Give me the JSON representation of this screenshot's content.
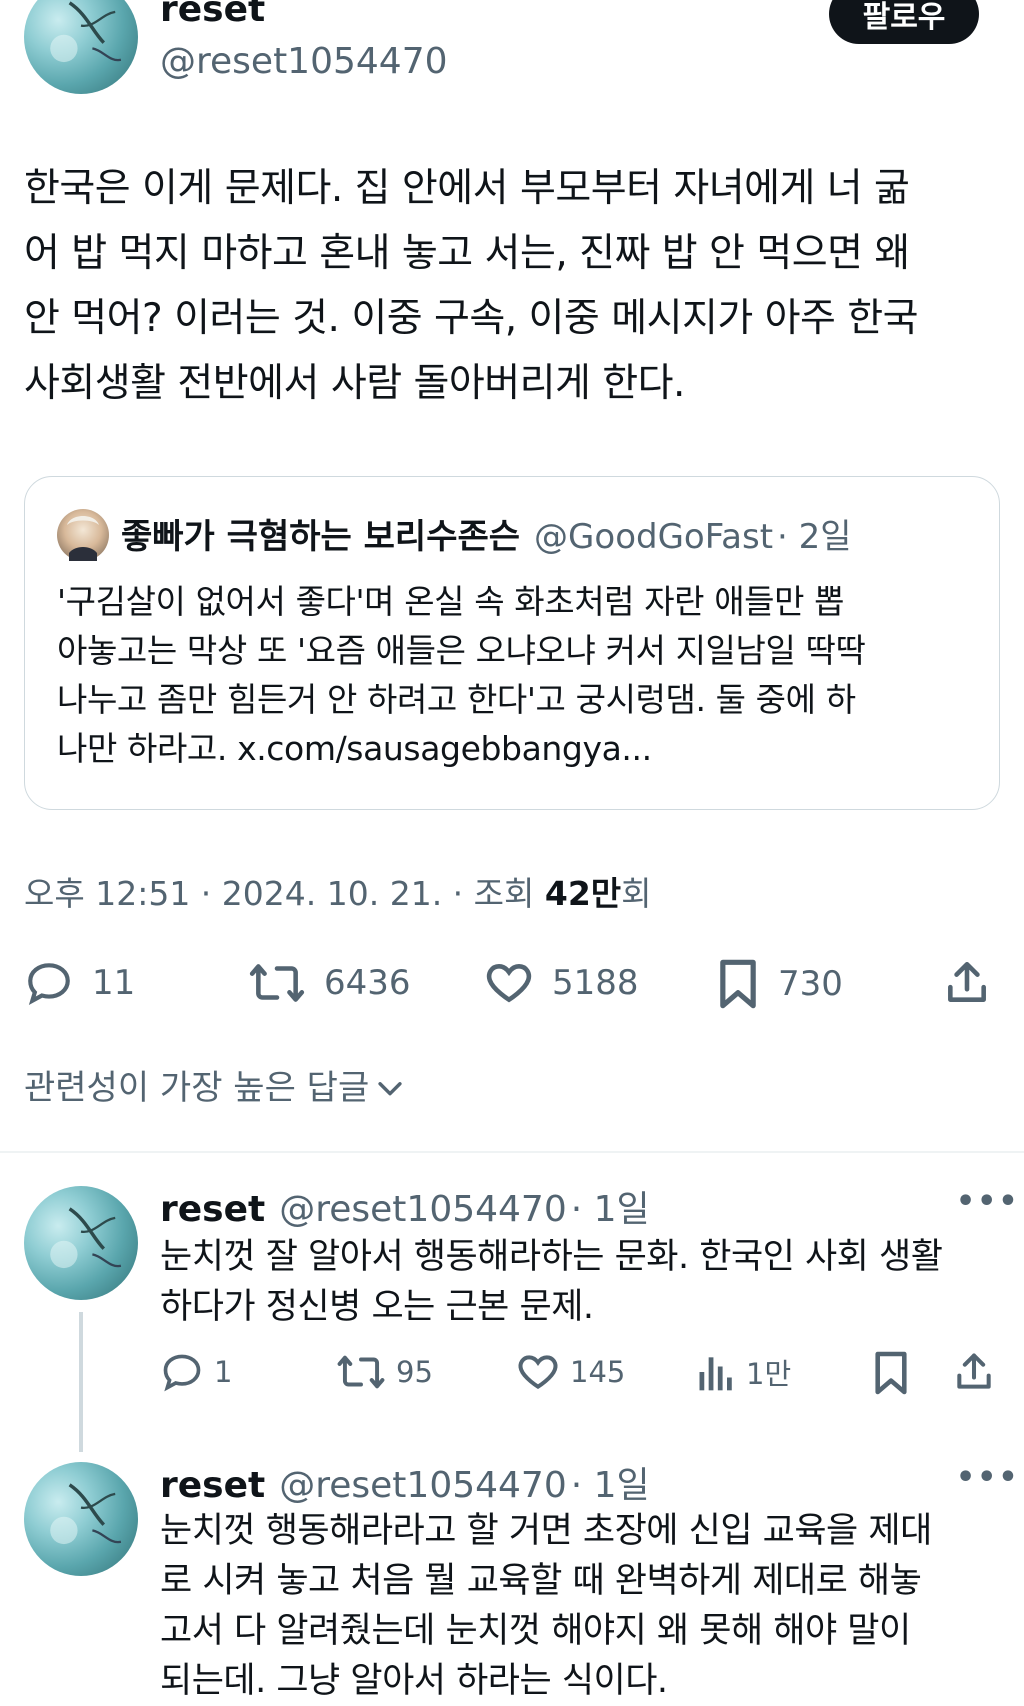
{
  "tweet": {
    "display_name": "reset",
    "handle": "@reset1054470",
    "follow_label": "팔로우",
    "text_lines": [
      "한국은 이게 문제다. 집 안에서 부모부터 자녀에게 너 굶",
      "어 밥 먹지 마하고 혼내 놓고 서는, 진짜 밥 안 먹으면 왜",
      "안 먹어? 이러는 것. 이중 구속, 이중 메시지가 아주 한국",
      "사회생활 전반에서 사람 돌아버리게 한다."
    ],
    "quote": {
      "display_name": "좋빠가 극혐하는 보리수존슨",
      "handle": "@GoodGoFast",
      "time": "· 2일",
      "text_lines": [
        "'구김살이 없어서 좋다'며 온실 속 화초처럼 자란 애들만 뽑",
        "아놓고는 막상 또 '요즘 애들은 오냐오냐 커서 지일남일 딱딱",
        "나누고 좀만 힘든거 안 하려고 한다'고 궁시렁댐. 둘 중에 하",
        "나만 하라고. x.com/sausagebbangya..."
      ]
    },
    "meta": {
      "time_date": "오후 12:51 · 2024. 10. 21. · 조회 ",
      "views_bold": "42만",
      "views_suffix": "회"
    },
    "actions": {
      "replies": "11",
      "retweets": "6436",
      "likes": "5188",
      "bookmarks": "730"
    }
  },
  "sort": {
    "label": "관련성이 가장 높은 답글"
  },
  "replies": [
    {
      "display_name": "reset",
      "handle": "@reset1054470",
      "time": "· 1일",
      "text_lines": [
        "눈치껏 잘 알아서 행동해라하는 문화. 한국인 사회 생활",
        "하다가 정신병 오는 근본 문제."
      ],
      "replies": "1",
      "retweets": "95",
      "likes": "145",
      "views": "1만"
    },
    {
      "display_name": "reset",
      "handle": "@reset1054470",
      "time": "· 1일",
      "text_lines": [
        "눈치껏 행동해라라고 할 거면 초장에 신입 교육을 제대",
        "로 시켜 놓고 처음 뭘 교육할 때 완벽하게 제대로 해놓",
        "고서 다 알려줬는데 눈치껏 해야지 왜 못해 해야 말이",
        "되는데. 그냥 알아서 하라는 식이다."
      ]
    }
  ],
  "icons": {
    "reply": "speech-bubble-icon",
    "retweet": "retweet-icon",
    "like": "heart-icon",
    "bookmark": "bookmark-icon",
    "share": "share-icon",
    "views": "bar-chart-icon",
    "more": "more-dots-icon",
    "chevron": "chevron-down-icon"
  }
}
